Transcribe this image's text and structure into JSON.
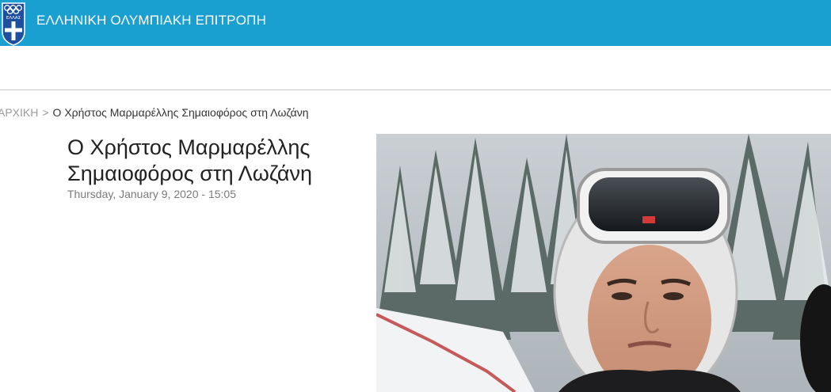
{
  "header": {
    "site_title": "ΕΛΛΗΝΙΚΗ ΟΛΥΜΠΙΑΚΗ ΕΠΙΤΡΟΠΗ",
    "logo_text": "ΕΛΛΑΣ",
    "bar_color": "#1a9fd1"
  },
  "breadcrumb": {
    "home": "ΑΡΧΙΚΗ",
    "separator": ">",
    "current": "Ο Χρήστος Μαρμαρέλλης Σημαιοφόρος στη Λωζάνη"
  },
  "article": {
    "title": "Ο Χρήστος Μαρμαρέλλης Σημαιοφόρος στη Λωζάνη",
    "date": "Thursday, January 9, 2020 - 15:05"
  },
  "photo": {
    "subject": "skier-portrait-photo"
  }
}
